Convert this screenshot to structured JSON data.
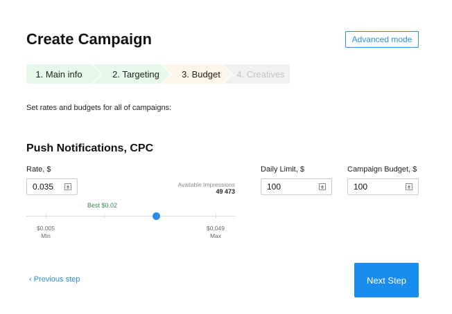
{
  "page": {
    "title": "Create Campaign",
    "advanced_mode_label": "Advanced mode"
  },
  "steps": [
    {
      "label": "1. Main info",
      "state": "done"
    },
    {
      "label": "2. Targeting",
      "state": "done"
    },
    {
      "label": "3. Budget",
      "state": "current"
    },
    {
      "label": "4. Creatives",
      "state": "disabled"
    }
  ],
  "description": "Set rates and budgets for all of campaigns:",
  "section": {
    "title": "Push Notifications, CPC",
    "rate": {
      "label": "Rate, $",
      "value": "0.035"
    },
    "daily_limit": {
      "label": "Daily Limit, $",
      "value": "100"
    },
    "campaign_budget": {
      "label": "Campaign Budget, $",
      "value": "100"
    },
    "impressions": {
      "label": "Available Impressions",
      "value": "49 473"
    },
    "slider": {
      "best_label": "Best $0.02",
      "min_value": "$0.005",
      "min_label": "Min",
      "max_value": "$0.049",
      "max_label": "Max",
      "fraction": 0.65
    }
  },
  "footer": {
    "prev_label": "Previous step",
    "next_label": "Next Step"
  },
  "colors": {
    "accent": "#2d8ce6",
    "done_step": "#e4f8ec",
    "current_step": "#fdf6e8",
    "best": "#2e8a4f"
  },
  "icons": {
    "prev": "chevron-left-icon",
    "spinner": "spinner-arrows-icon"
  }
}
